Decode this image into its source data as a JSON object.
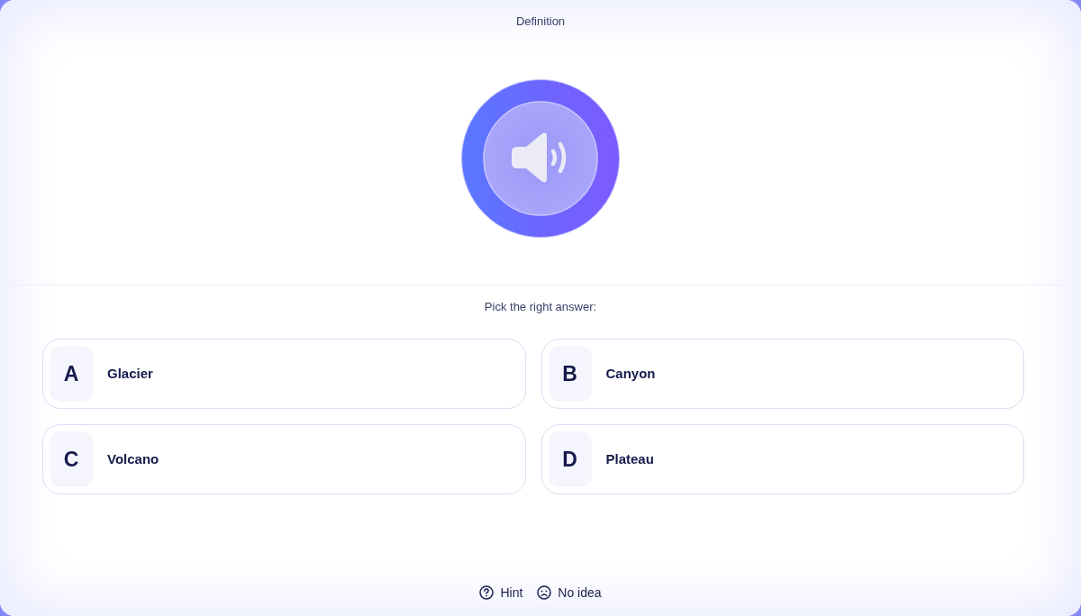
{
  "header": {
    "title": "Definition"
  },
  "prompt": "Pick the right answer:",
  "options": [
    {
      "letter": "A",
      "label": "Glacier",
      "selected": false
    },
    {
      "letter": "B",
      "label": "Canyon",
      "selected": false
    },
    {
      "letter": "C",
      "label": "Volcano",
      "selected": false
    },
    {
      "letter": "D",
      "label": "Plateau",
      "selected": false
    }
  ],
  "actions": [
    {
      "kind": "hint",
      "label": "Hint"
    },
    {
      "kind": "no_idea",
      "label": "No idea"
    }
  ]
}
